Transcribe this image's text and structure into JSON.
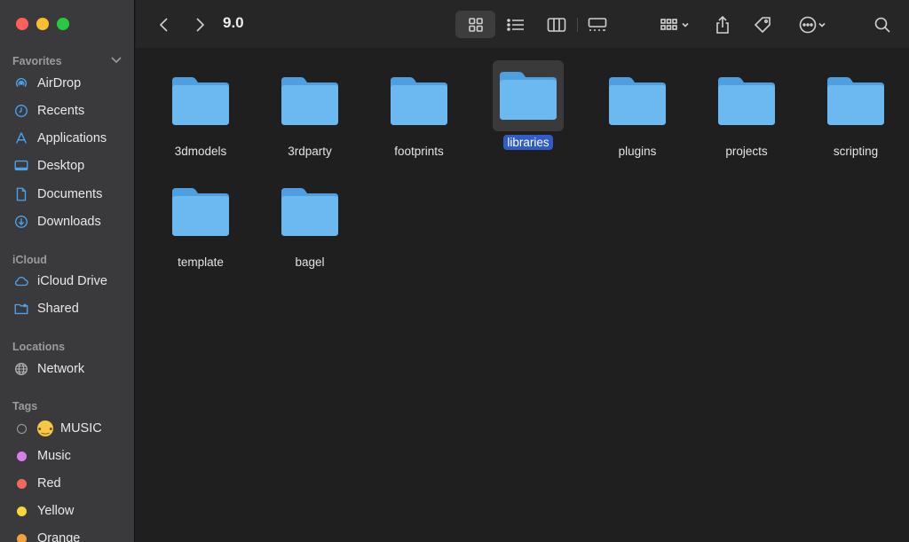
{
  "toolbar": {
    "title": "9.0"
  },
  "sidebar": {
    "favorites_title": "Favorites",
    "favorites": [
      {
        "label": "AirDrop",
        "icon": "airdrop-icon"
      },
      {
        "label": "Recents",
        "icon": "clock-icon"
      },
      {
        "label": "Applications",
        "icon": "applications-icon"
      },
      {
        "label": "Desktop",
        "icon": "desktop-icon"
      },
      {
        "label": "Documents",
        "icon": "document-icon"
      },
      {
        "label": "Downloads",
        "icon": "download-icon"
      }
    ],
    "icloud_title": "iCloud",
    "icloud": [
      {
        "label": "iCloud Drive",
        "icon": "cloud-icon"
      },
      {
        "label": "Shared",
        "icon": "shared-folder-icon"
      }
    ],
    "locations_title": "Locations",
    "locations": [
      {
        "label": "Network",
        "icon": "globe-icon"
      }
    ],
    "tags_title": "Tags",
    "tags": [
      {
        "label": "MUSIC",
        "color": ""
      },
      {
        "label": "Music",
        "color": "#d77ee8"
      },
      {
        "label": "Red",
        "color": "#f06a5c"
      },
      {
        "label": "Yellow",
        "color": "#f7d63b"
      },
      {
        "label": "Orange",
        "color": "#f5a13a"
      }
    ]
  },
  "files": [
    {
      "name": "3dmodels",
      "selected": false
    },
    {
      "name": "3rdparty",
      "selected": false
    },
    {
      "name": "footprints",
      "selected": false
    },
    {
      "name": "libraries",
      "selected": true
    },
    {
      "name": "plugins",
      "selected": false
    },
    {
      "name": "projects",
      "selected": false
    },
    {
      "name": "scripting",
      "selected": false
    },
    {
      "name": "template",
      "selected": false
    },
    {
      "name": "bagel",
      "selected": false
    }
  ],
  "colors": {
    "accent": "#2f5cc9",
    "folder": "#6cb8f0",
    "sidebar_icon": "#4ba3f0"
  }
}
